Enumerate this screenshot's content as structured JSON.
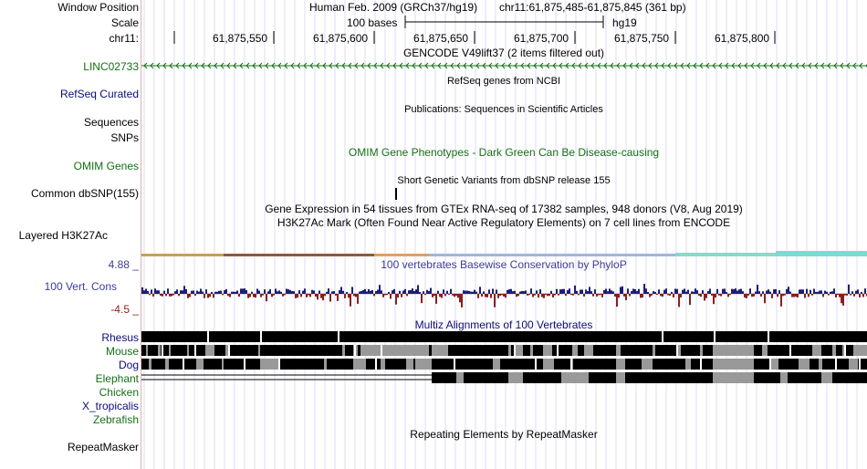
{
  "header": {
    "window_position_label": "Window Position",
    "scale_label": "Scale",
    "chrom_label": "chr11:",
    "assembly": "Human Feb. 2009 (GRCh37/hg19)",
    "position": "chr11:61,875,485-61,875,845 (361 bp)",
    "scale_value": "100 bases",
    "scale_db": "hg19",
    "ruler_ticks": [
      "61,875,550",
      "61,875,600",
      "61,875,650",
      "61,875,700",
      "61,875,750",
      "61,875,800"
    ]
  },
  "tracks": {
    "gencode": {
      "title": "GENCODE V49lift37 (2 items filtered out)",
      "gene": "LINC02733",
      "color": "#157015"
    },
    "refseq": {
      "label": "RefSeq Curated",
      "title": "RefSeq genes from NCBI",
      "color": "#0c0c78"
    },
    "pubs": {
      "label": "Sequences",
      "title": "Publications: Sequences in Scientific Articles"
    },
    "snps": {
      "label": "SNPs"
    },
    "omim": {
      "label": "OMIM Genes",
      "title": "OMIM Gene Phenotypes - Dark Green Can Be Disease-causing",
      "color": "#157015"
    },
    "dbsnp": {
      "label": "Common dbSNP(155)",
      "title": "Short Genetic Variants from dbSNP release 155"
    },
    "gtex": {
      "title": "Gene Expression in 54 tissues from GTEx RNA-seq of 17382 samples, 948 donors (V8, Aug 2019)"
    },
    "h3k27ac": {
      "label": "Layered H3K27Ac",
      "title": "H3K27Ac Mark (Often Found Near Active Regulatory Elements) on 7 cell lines from ENCODE"
    },
    "phylop": {
      "label": "100 Vert. Cons",
      "title": "100 vertebrates Basewise Conservation by PhyloP",
      "max": "4.88 _",
      "min": "-4.5 _",
      "color": "#3c3c9a",
      "pos_color": "#1e1e78",
      "neg_color": "#8c1e1e"
    },
    "multiz": {
      "title": "Multiz Alignments of 100 Vertebrates",
      "species": [
        {
          "name": "Rhesus",
          "color": "#0c0c78"
        },
        {
          "name": "Mouse",
          "color": "#157015"
        },
        {
          "name": "Dog",
          "color": "#0c0c78"
        },
        {
          "name": "Elephant",
          "color": "#157015"
        },
        {
          "name": "Chicken",
          "color": "#157015"
        },
        {
          "name": "X_tropicalis",
          "color": "#0c0c78"
        },
        {
          "name": "Zebrafish",
          "color": "#157015"
        }
      ]
    },
    "repeatmasker": {
      "label": "RepeatMasker",
      "title": "Repeating Elements by RepeatMasker"
    }
  }
}
